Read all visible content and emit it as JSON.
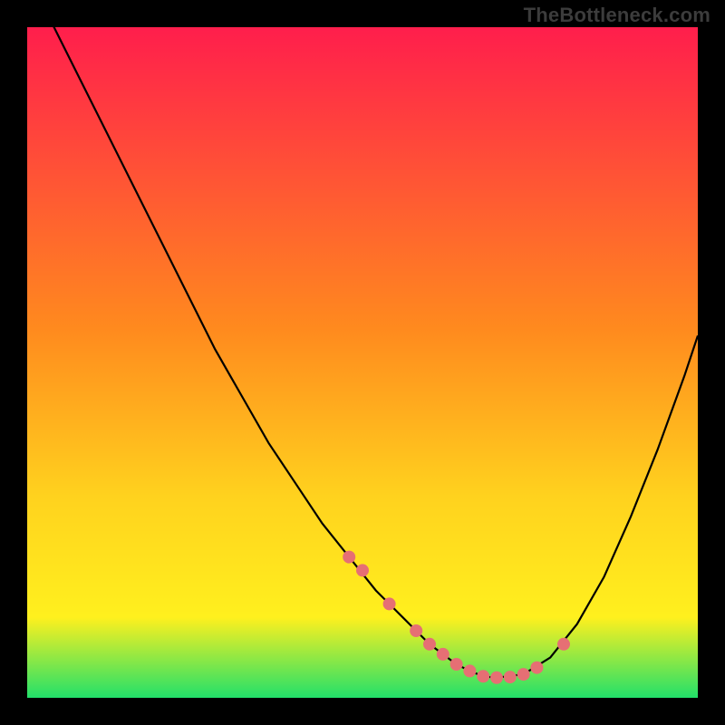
{
  "watermark": "TheBottleneck.com",
  "colors": {
    "background": "#000000",
    "grad_top": "#ff1e4c",
    "grad_mid1": "#ff8a1e",
    "grad_mid2": "#ffd21e",
    "grad_mid3": "#fff01e",
    "grad_bot": "#22e06a",
    "curve": "#000000",
    "marker_fill": "#e66f74",
    "marker_stroke": "#e66f74"
  },
  "chart_data": {
    "type": "line",
    "title": "",
    "xlabel": "",
    "ylabel": "",
    "xlim": [
      0,
      100
    ],
    "ylim": [
      0,
      100
    ],
    "series": [
      {
        "name": "bottleneck-curve",
        "x": [
          0,
          4,
          8,
          12,
          16,
          20,
          24,
          28,
          32,
          36,
          40,
          44,
          48,
          52,
          54,
          56,
          58,
          60,
          62,
          64,
          66,
          68,
          70,
          74,
          78,
          82,
          86,
          90,
          94,
          98,
          100
        ],
        "values": [
          108,
          100,
          92,
          84,
          76,
          68,
          60,
          52,
          45,
          38,
          32,
          26,
          21,
          16,
          14,
          12,
          10,
          8,
          6.5,
          5,
          4,
          3.2,
          3,
          3.5,
          6,
          11,
          18,
          27,
          37,
          48,
          54
        ]
      },
      {
        "name": "highlight-markers",
        "x": [
          48,
          50,
          54,
          58,
          60,
          62,
          64,
          66,
          68,
          70,
          72,
          74,
          76,
          80
        ],
        "values": [
          21,
          19,
          14,
          10,
          8,
          6.5,
          5,
          4,
          3.2,
          3,
          3.1,
          3.5,
          4.5,
          8
        ]
      }
    ],
    "gradient_stops": [
      {
        "offset": 0.0,
        "key": "grad_top"
      },
      {
        "offset": 0.45,
        "key": "grad_mid1"
      },
      {
        "offset": 0.7,
        "key": "grad_mid2"
      },
      {
        "offset": 0.88,
        "key": "grad_mid3"
      },
      {
        "offset": 1.0,
        "key": "grad_bot"
      }
    ]
  }
}
